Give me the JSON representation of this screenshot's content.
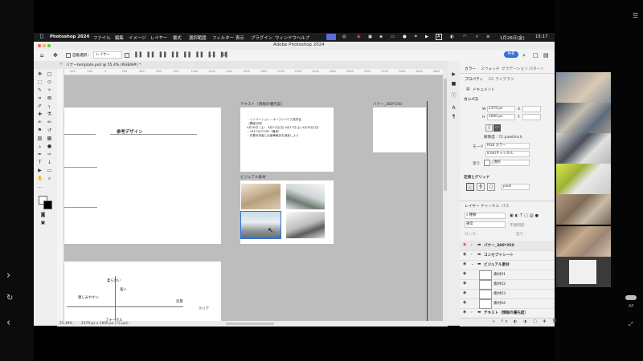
{
  "leftnav": {
    "icons": [
      "chevron-right-icon",
      "refresh-icon",
      "chevron-left-icon"
    ]
  },
  "rightstrip": {
    "ap_label": "AP"
  },
  "menubar": {
    "app": "Photoshop 2024",
    "items": [
      "ファイル",
      "編集",
      "イメージ",
      "レイヤー",
      "書式",
      "選択範囲",
      "フィルター",
      "表示",
      "プラグイン",
      "ウィンドウ",
      "ヘルプ"
    ],
    "input_mode": "A",
    "date": "1月26日(金)",
    "time": "15:17"
  },
  "titlebar": {
    "title": "Adobe Photoshop 2024",
    "share": "共有"
  },
  "optionsbar": {
    "auto_select_label": "自動選択 :",
    "auto_select_value": "レイヤー"
  },
  "document": {
    "tab_title": "バナーtemplate.psd @ 55.4% (RGB/8#) *",
    "ruler_ticks": [
      "400",
      "200",
      "0",
      "200",
      "400",
      "600",
      "800",
      "1000",
      "1200",
      "1400",
      "1600",
      "1800",
      "2000",
      "2200",
      "2400",
      "2600",
      "2800",
      "3000",
      "3200",
      "3400",
      "3600",
      "3800"
    ],
    "zoom": "55.39%",
    "doc_info": "2379 px x 1600 px (72 ppi)"
  },
  "canvas": {
    "ref_design_title": "参考デザイン",
    "text_artboard_label": "テキスト（情報の優先度）",
    "text_lines": [
      "・リノベーション・オープンハウス見学会",
      "（開催日時）",
      "4月16日（土） 4月11日(日)  4月17日(土)  4月18日(日)",
      "・LIFE FACTORY（備考）",
      "・先着利用者には豪華景品を進呈しよう"
    ],
    "visual_label": "ビジュアル素材",
    "banner_label": "バナー_300*250",
    "words": {
      "soft": "柔らかい",
      "friendly": "親しみやすい",
      "strong": "強い",
      "cool": "涼景",
      "clear": "クリア",
      "formal": "フォーマル"
    }
  },
  "panels": {
    "top_tabs": [
      "カラー",
      "スウォッチ",
      "グラデーション",
      "パターン"
    ],
    "prop_tabs": [
      "プロパティ",
      "CC ライブラリ"
    ],
    "doc_label": "ドキュメント",
    "canvas_header": "カンバス",
    "w_label": "W",
    "w_value": "2379 px",
    "h_label": "H",
    "h_value": "1600 px",
    "x_label": "X",
    "y_label": "Y",
    "resolution": "解像度 : 72 pixel/inch",
    "mode_label": "モード",
    "mode_value": "RGB カラー",
    "depth_value": "8 bit/チャンネル",
    "fill_label": "塗り",
    "fill_value": "透明",
    "rulers_header": "定規とグリッド",
    "grid_unit": "pixel",
    "layer_tabs": [
      "レイヤー",
      "チャンネル",
      "パス"
    ],
    "search_kind": "種類",
    "blend_mode": "通常",
    "opacity_label": "不透明度 :",
    "lock_label": "ロック：",
    "fill_row_label": "塗り :",
    "layers": [
      {
        "name": "バナー_300*250",
        "type": "group",
        "selected": true
      },
      {
        "name": "コンセプトシート",
        "type": "group",
        "selected": false
      },
      {
        "name": "ビジュアル素材",
        "type": "group-open",
        "selected": false
      },
      {
        "name": "素材01",
        "type": "layer",
        "selected": false
      },
      {
        "name": "素材02",
        "type": "layer",
        "selected": false
      },
      {
        "name": "素材03",
        "type": "layer",
        "selected": false
      },
      {
        "name": "素材04",
        "type": "layer",
        "selected": false
      },
      {
        "name": "テキスト（情報の優先度）",
        "type": "group",
        "selected": false
      }
    ]
  },
  "colors": {
    "accent": "#2f6fe0",
    "layer_selected": "#e8e8e8",
    "eye_red": "#e04040"
  }
}
